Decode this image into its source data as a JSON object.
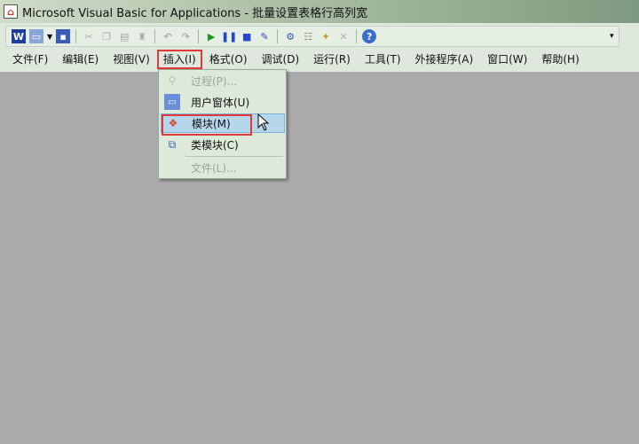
{
  "window": {
    "title": "Microsoft Visual Basic for Applications - 批量设置表格行高列宽"
  },
  "toolbar": {
    "icons": [
      "excel-view-icon",
      "insert-userform-icon",
      "save-icon",
      "cut-icon",
      "copy-icon",
      "paste-icon",
      "find-icon",
      "undo-icon",
      "redo-icon",
      "run-icon",
      "break-icon",
      "reset-icon",
      "design-mode-icon",
      "project-explorer-icon",
      "properties-icon",
      "object-browser-icon",
      "toolbox-icon",
      "help-icon"
    ]
  },
  "menubar": {
    "items": [
      "文件(F)",
      "编辑(E)",
      "视图(V)",
      "插入(I)",
      "格式(O)",
      "调试(D)",
      "运行(R)",
      "工具(T)",
      "外接程序(A)",
      "窗口(W)",
      "帮助(H)"
    ]
  },
  "insert_menu": {
    "items": [
      {
        "label": "过程(P)...",
        "enabled": false
      },
      {
        "label": "用户窗体(U)",
        "enabled": true
      },
      {
        "label": "模块(M)",
        "enabled": true,
        "highlighted": true
      },
      {
        "label": "类模块(C)",
        "enabled": true
      },
      {
        "label": "文件(L)...",
        "enabled": false
      }
    ]
  },
  "colors": {
    "highlight": "#e0393a",
    "menu_bg": "#dde9d9",
    "workspace": "#ababab"
  }
}
